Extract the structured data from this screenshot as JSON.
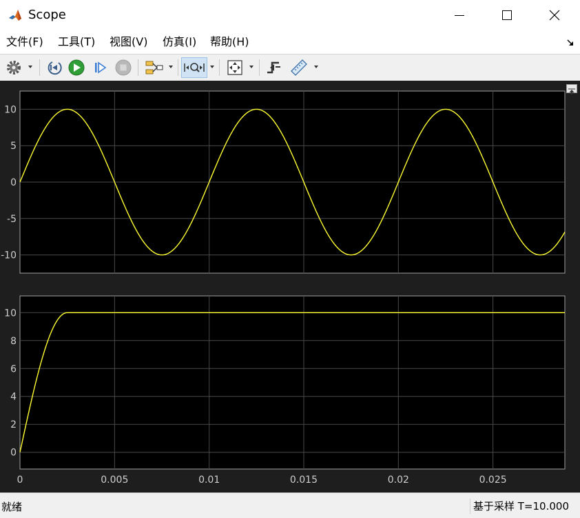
{
  "window": {
    "title": "Scope"
  },
  "menu": {
    "items": [
      "文件(F)",
      "工具(T)",
      "视图(V)",
      "仿真(I)",
      "帮助(H)"
    ]
  },
  "toolbar": {
    "buttons": [
      "settings-icon",
      "step-back-icon",
      "run-icon",
      "step-forward-icon",
      "stop-icon",
      "signal-selector-icon",
      "zoom-time-icon",
      "autoscale-icon",
      "triggers-icon",
      "measurements-icon"
    ],
    "active_button": "zoom-time-icon"
  },
  "plot": {
    "background": "#000000",
    "grid_color": "#4a4a4a",
    "trace_color": "#ffff33",
    "x_range": [
      0,
      0.0288
    ],
    "x_ticks": [
      0,
      0.005,
      0.01,
      0.015,
      0.02,
      0.025
    ],
    "x_tick_labels": [
      "0",
      "0.005",
      "0.01",
      "0.015",
      "0.02",
      "0.025"
    ]
  },
  "chart_data": [
    {
      "type": "line",
      "title": "",
      "xlabel": "",
      "ylabel": "",
      "grid": true,
      "xlim": [
        0,
        0.0288
      ],
      "ylim": [
        -12.5,
        12.5
      ],
      "y_ticks": [
        10,
        5,
        0,
        -5,
        -10
      ],
      "y_tick_labels": [
        "10",
        "5",
        "0",
        "-5",
        "-10"
      ],
      "series": [
        {
          "function": "10*sin(2*pi*100*t)",
          "amplitude": 10,
          "frequency_hz": 100,
          "x": [
            0,
            0.0025,
            0.005,
            0.0075,
            0.01,
            0.0125,
            0.015,
            0.0175,
            0.02,
            0.0225,
            0.025,
            0.0275,
            0.0288
          ],
          "values": [
            0,
            10,
            0,
            -10,
            0,
            10,
            0,
            -10,
            0,
            10,
            0,
            -10,
            -7.5
          ]
        }
      ]
    },
    {
      "type": "line",
      "title": "",
      "xlabel": "",
      "ylabel": "",
      "grid": true,
      "xlim": [
        0,
        0.0288
      ],
      "ylim": [
        -1.2,
        11.2
      ],
      "y_ticks": [
        10,
        8,
        6,
        4,
        2,
        0
      ],
      "y_tick_labels": [
        "10",
        "8",
        "6",
        "4",
        "2",
        "0"
      ],
      "series": [
        {
          "function": "10*sin(2*pi*100*t) for t<0.0025, then 10",
          "amplitude": 10,
          "frequency_hz": 100,
          "saturation_time": 0.0025,
          "x": [
            0,
            0.0025,
            0.0288
          ],
          "values": [
            0,
            10,
            10
          ]
        }
      ]
    }
  ],
  "status": {
    "left": "就绪",
    "right": "基于采样 T=10.000"
  }
}
